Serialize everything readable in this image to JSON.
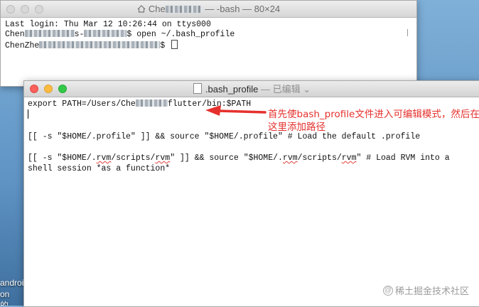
{
  "terminal": {
    "title_prefix": "Che",
    "title_suffix": " — -bash — 80×24",
    "line1": "Last login: Thu Mar 12 10:26:44 on ttys000",
    "line2_start": "Chen",
    "line2_mid": "s-",
    "line2_end": "$ open ~/.bash_profile",
    "line3_start": "ChenZhe",
    "line3_end": "$ "
  },
  "editor": {
    "filename": ".bash_profile",
    "subtitle": " — 已编辑 ",
    "chevron": "⌄",
    "line1_start": "export PATH=/Users/Che",
    "line1_end": "flutter/bin:$PATH",
    "line3": "[[ -s \"$HOME/.profile\" ]] && source \"$HOME/.profile\" # Load the default .profile",
    "line5_a": "[[ -s \"$HOME/.",
    "line5_b": "rvm",
    "line5_c": "/scripts/",
    "line5_d": "rvm",
    "line5_e": "\" ]] && source \"$HOME/.",
    "line5_f": "rvm",
    "line5_g": "/scripts/",
    "line5_h": "rvm",
    "line5_i": "\" # Load RVM into a",
    "line6": "shell session *as a function*"
  },
  "annotation": {
    "text": "首先使bash_profile文件进入可编辑模式，然后在这里添加路径",
    "color": "#e5312d"
  },
  "desktop": {
    "text1": "android",
    "text2": "on的..."
  },
  "watermark": {
    "text": "稀土掘金技术社区"
  }
}
